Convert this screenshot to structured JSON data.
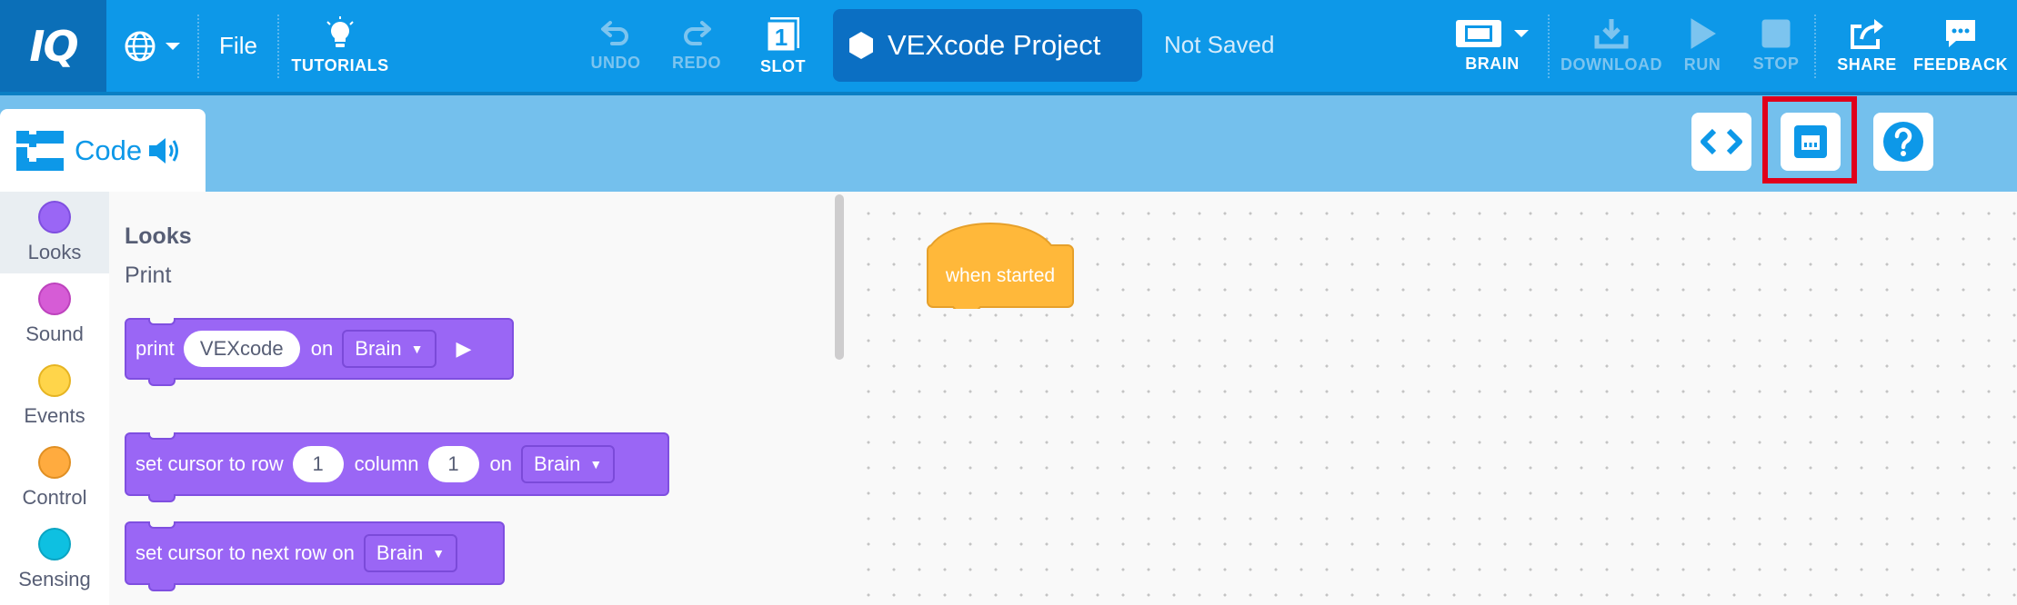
{
  "app": {
    "logo_text": "IQ",
    "brand_color": "#0d98e8",
    "logo_bg": "#0b6fb8"
  },
  "toolbar": {
    "file_label": "File",
    "tutorials_label": "TUTORIALS",
    "undo_label": "UNDO",
    "redo_label": "REDO",
    "slot_label": "SLOT",
    "slot_number": "1",
    "project_name": "VEXcode Project",
    "save_status": "Not Saved",
    "brain_label": "BRAIN",
    "download_label": "DOWNLOAD",
    "run_label": "RUN",
    "stop_label": "STOP",
    "share_label": "SHARE",
    "feedback_label": "FEEDBACK",
    "icons": {
      "language": "globe-icon",
      "tutorials": "lightbulb-icon",
      "undo": "undo-icon",
      "redo": "redo-icon",
      "slot": "slot-icon",
      "project": "hexagon-icon",
      "brain": "brain-device-icon",
      "download": "download-icon",
      "run": "play-icon",
      "stop": "stop-icon",
      "share": "share-icon",
      "feedback": "feedback-icon"
    }
  },
  "subbar": {
    "code_tab_label": "Code",
    "highlight_color": "#e0001b",
    "tools": [
      "code-view-icon",
      "devices-icon",
      "help-icon"
    ]
  },
  "categories": [
    {
      "label": "Looks",
      "color": "#9a66f5",
      "active": true
    },
    {
      "label": "Sound",
      "color": "#d65cd6",
      "active": false
    },
    {
      "label": "Events",
      "color": "#ffd54a",
      "active": false
    },
    {
      "label": "Control",
      "color": "#ffab3f",
      "active": false
    },
    {
      "label": "Sensing",
      "color": "#0ec0e1",
      "active": false
    }
  ],
  "palette": {
    "heading": "Looks",
    "subheading": "Print",
    "blocks": {
      "print": {
        "text": "print",
        "value": "VEXcode",
        "on": "on",
        "target": "Brain"
      },
      "set_cursor": {
        "text": "set cursor to row",
        "row": "1",
        "column_text": "column",
        "column": "1",
        "on": "on",
        "target": "Brain"
      },
      "next_row": {
        "text": "set cursor to next row on",
        "target": "Brain"
      }
    }
  },
  "workspace": {
    "hat_block_label": "when started",
    "hat_color": "#ffb83a"
  }
}
